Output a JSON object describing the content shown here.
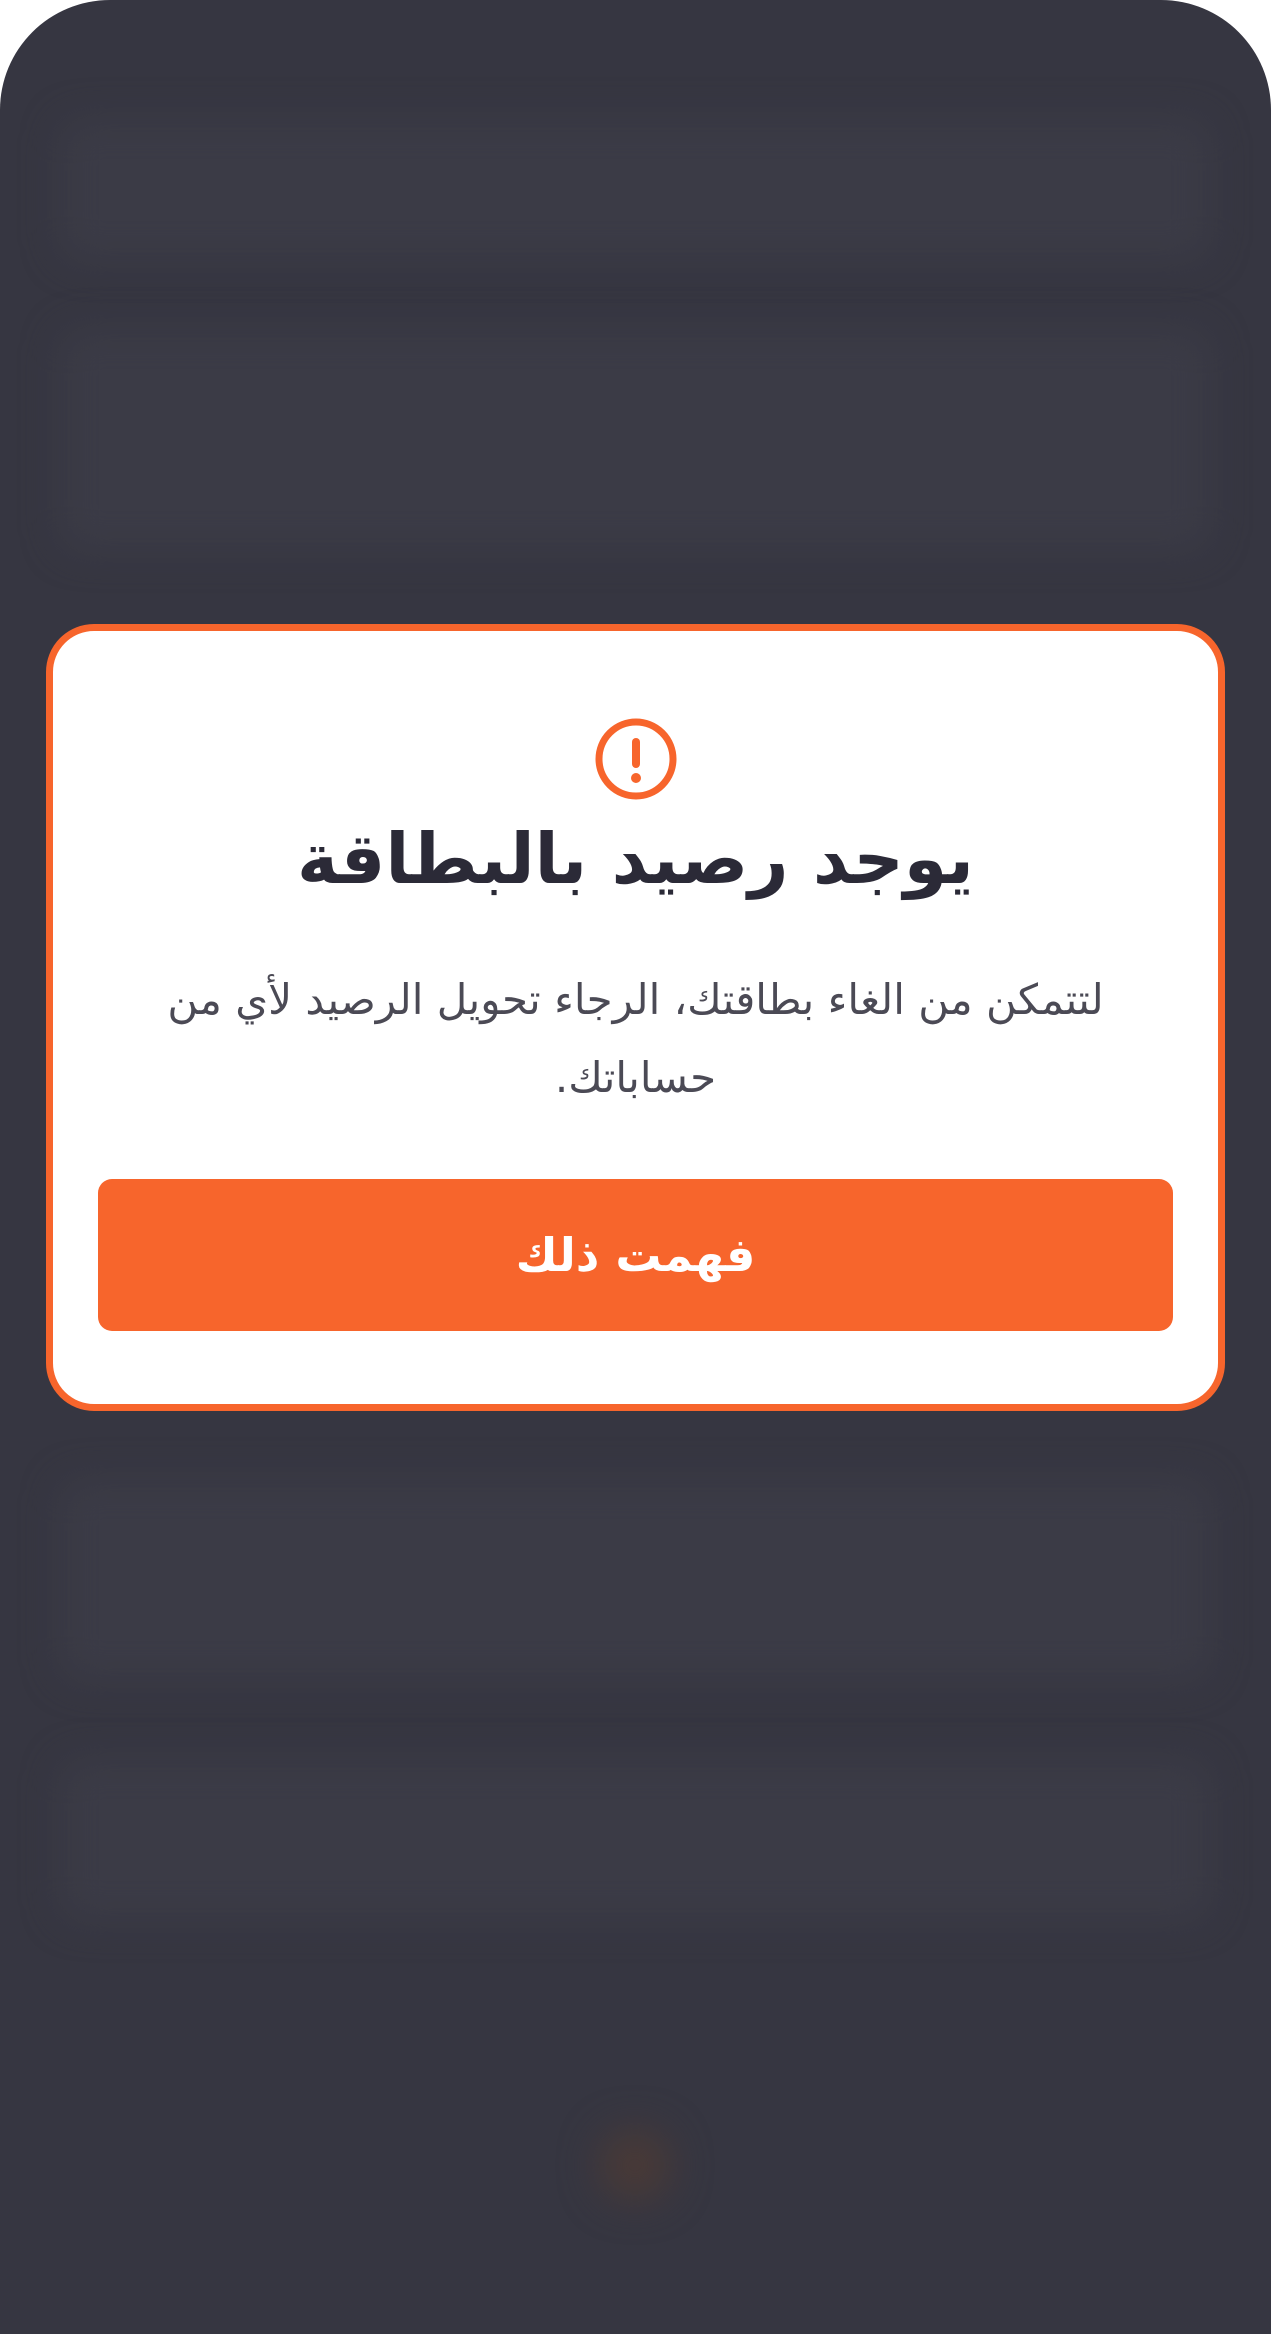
{
  "dialog": {
    "icon": "alert-circle-icon",
    "title": "يوجد رصيد بالبطاقة",
    "message": "لتتمكن من الغاء بطاقتك، الرجاء تحويل الرصيد لأي من حساباتك.",
    "button_label": "فهمت ذلك"
  },
  "colors": {
    "accent": "#f7652c",
    "backdrop": "#363641",
    "title_text": "#2b2a37",
    "body_text": "#4b4a55",
    "dialog_background": "#ffffff"
  }
}
